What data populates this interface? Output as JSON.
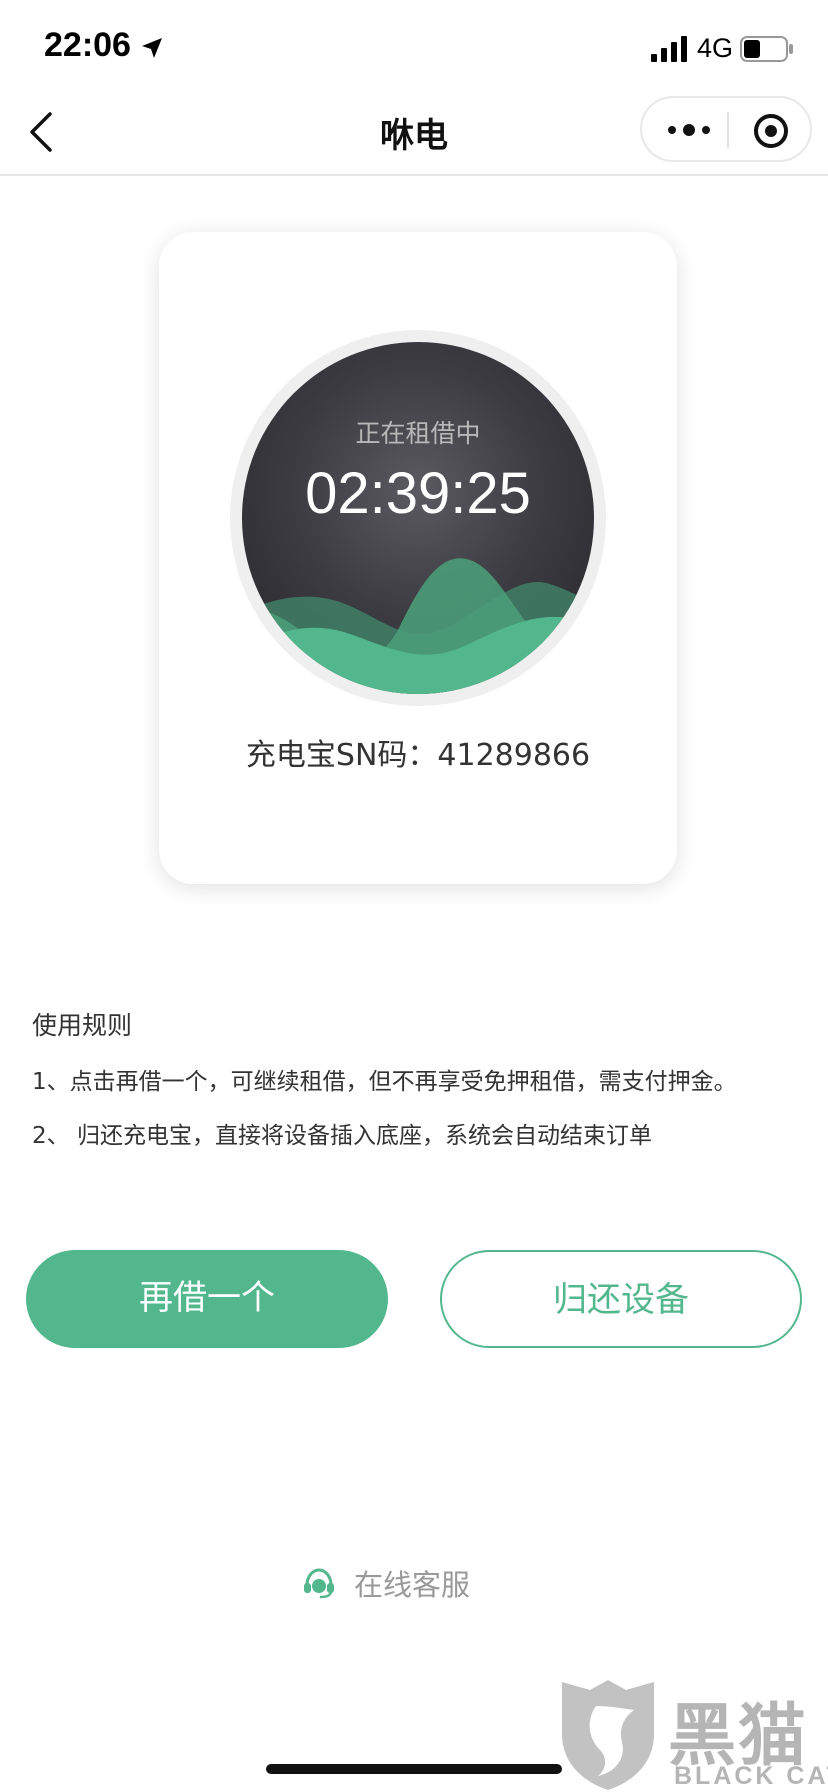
{
  "status_bar": {
    "time": "22:06",
    "network": "4G",
    "icons": [
      "location-arrow-icon",
      "signal-icon",
      "battery-icon"
    ]
  },
  "nav": {
    "title": "咻电",
    "icons": [
      "back-icon",
      "more-icon",
      "target-icon"
    ]
  },
  "card": {
    "status": "正在租借中",
    "timer": "02:39:25",
    "sn_label": "充电宝SN码：41289866"
  },
  "rules": {
    "title": "使用规则",
    "items": [
      "1、点击再借一个，可继续租借，但不再享受免押租借，需支付押金。",
      "2、 归还充电宝，直接将设备插入底座，系统会自动结束订单"
    ]
  },
  "buttons": {
    "borrow_again": "再借一个",
    "return_device": "归还设备"
  },
  "service": {
    "label": "在线客服",
    "icon": "headset-icon"
  },
  "watermark": {
    "cn": "黑猫",
    "en": "BLACK CAT"
  },
  "colors": {
    "accent": "#53b78d",
    "dial_dark": "#3a3a40",
    "muted_text": "#999999"
  }
}
